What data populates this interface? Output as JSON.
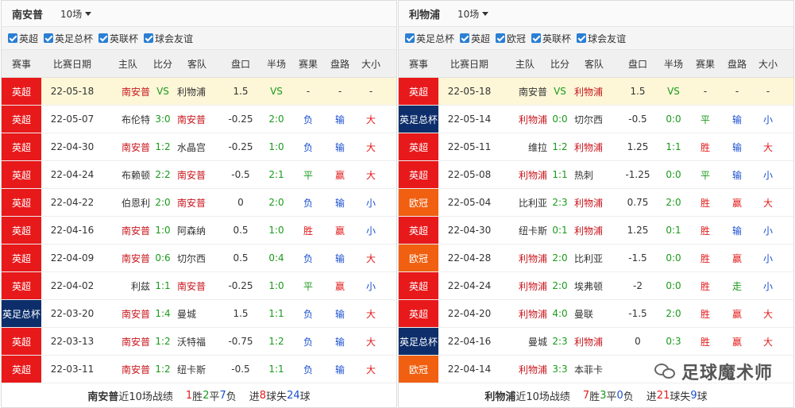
{
  "colors": {
    "epl": "#e8191b",
    "league_cup": "#0d2e6a",
    "europa": "#f06010",
    "highlight_row": "#fdf7d8"
  },
  "headers": {
    "comp": "赛事",
    "date": "比赛日期",
    "home": "主队",
    "score": "比分",
    "away": "客队",
    "handicap": "盘口",
    "halftime": "半场",
    "result": "赛果",
    "pl": "盘路",
    "ou": "大小"
  },
  "left": {
    "team": "南安普",
    "select": "10场",
    "filters": [
      "英超",
      "英足总杯",
      "英联杯",
      "球会友谊"
    ],
    "rows": [
      {
        "comp": "英超",
        "comp_type": "epl",
        "date": "22-05-18",
        "home": "南安普",
        "score": "VS",
        "away": "利物浦",
        "hcp": "1.5",
        "ht": "VS",
        "res": "-",
        "pl": "-",
        "ou": "-",
        "hl": true,
        "home_hl": true,
        "away_hl": false,
        "res_c": "dark",
        "pl_c": "dark",
        "ou_c": "dark"
      },
      {
        "comp": "英超",
        "comp_type": "epl",
        "date": "22-05-07",
        "home": "布伦特",
        "score": "3:0",
        "away": "南安普",
        "hcp": "-0.25",
        "ht": "2:0",
        "res": "负",
        "pl": "输",
        "ou": "大",
        "home_hl": false,
        "away_hl": true,
        "res_c": "blue",
        "pl_c": "blue",
        "ou_c": "red"
      },
      {
        "comp": "英超",
        "comp_type": "epl",
        "date": "22-04-30",
        "home": "南安普",
        "score": "1:2",
        "away": "水晶宫",
        "hcp": "-0.25",
        "ht": "1:0",
        "res": "负",
        "pl": "输",
        "ou": "大",
        "home_hl": true,
        "away_hl": false,
        "res_c": "blue",
        "pl_c": "blue",
        "ou_c": "red"
      },
      {
        "comp": "英超",
        "comp_type": "epl",
        "date": "22-04-24",
        "home": "布赖顿",
        "score": "2:2",
        "away": "南安普",
        "hcp": "-0.5",
        "ht": "2:1",
        "res": "平",
        "pl": "赢",
        "ou": "大",
        "home_hl": false,
        "away_hl": true,
        "res_c": "green",
        "pl_c": "red",
        "ou_c": "red"
      },
      {
        "comp": "英超",
        "comp_type": "epl",
        "date": "22-04-22",
        "home": "伯恩利",
        "score": "2:0",
        "away": "南安普",
        "hcp": "0",
        "ht": "2:0",
        "res": "负",
        "pl": "输",
        "ou": "小",
        "home_hl": false,
        "away_hl": true,
        "res_c": "blue",
        "pl_c": "blue",
        "ou_c": "blue"
      },
      {
        "comp": "英超",
        "comp_type": "epl",
        "date": "22-04-16",
        "home": "南安普",
        "score": "1:0",
        "away": "阿森纳",
        "hcp": "0.5",
        "ht": "1:0",
        "res": "胜",
        "pl": "赢",
        "ou": "小",
        "home_hl": true,
        "away_hl": false,
        "res_c": "red",
        "pl_c": "red",
        "ou_c": "blue"
      },
      {
        "comp": "英超",
        "comp_type": "epl",
        "date": "22-04-09",
        "home": "南安普",
        "score": "0:6",
        "away": "切尔西",
        "hcp": "0.5",
        "ht": "0:4",
        "res": "负",
        "pl": "输",
        "ou": "大",
        "home_hl": true,
        "away_hl": false,
        "res_c": "blue",
        "pl_c": "blue",
        "ou_c": "red"
      },
      {
        "comp": "英超",
        "comp_type": "epl",
        "date": "22-04-02",
        "home": "利兹",
        "score": "1:1",
        "away": "南安普",
        "hcp": "-0.25",
        "ht": "1:0",
        "res": "平",
        "pl": "赢",
        "ou": "小",
        "home_hl": false,
        "away_hl": true,
        "res_c": "green",
        "pl_c": "red",
        "ou_c": "blue"
      },
      {
        "comp": "英足总杯",
        "comp_type": "league_cup",
        "date": "22-03-20",
        "home": "南安普",
        "score": "1:4",
        "away": "曼城",
        "hcp": "1.5",
        "ht": "1:1",
        "res": "负",
        "pl": "输",
        "ou": "大",
        "home_hl": true,
        "away_hl": false,
        "res_c": "blue",
        "pl_c": "blue",
        "ou_c": "red"
      },
      {
        "comp": "英超",
        "comp_type": "epl",
        "date": "22-03-13",
        "home": "南安普",
        "score": "1:2",
        "away": "沃特福",
        "hcp": "-0.75",
        "ht": "1:2",
        "res": "负",
        "pl": "输",
        "ou": "大",
        "home_hl": true,
        "away_hl": false,
        "res_c": "blue",
        "pl_c": "blue",
        "ou_c": "red"
      },
      {
        "comp": "英超",
        "comp_type": "epl",
        "date": "22-03-11",
        "home": "南安普",
        "score": "1:2",
        "away": "纽卡斯",
        "hcp": "-0.5",
        "ht": "1:1",
        "res": "负",
        "pl": "输",
        "ou": "大",
        "home_hl": true,
        "away_hl": false,
        "res_c": "blue",
        "pl_c": "blue",
        "ou_c": "red"
      }
    ],
    "footer": {
      "team": "南安普",
      "label": "近10场战绩",
      "w": "1",
      "w_unit": "胜",
      "d": "2",
      "d_unit": "平",
      "l": "7",
      "l_unit": "负",
      "gf_label": "进",
      "gf": "8",
      "gf_unit": "球失",
      "ga": "24",
      "ga_unit": "球"
    }
  },
  "right": {
    "team": "利物浦",
    "select": "10场",
    "filters": [
      "英足总杯",
      "英超",
      "欧冠",
      "英联杯",
      "球会友谊"
    ],
    "rows": [
      {
        "comp": "英超",
        "comp_type": "epl",
        "date": "22-05-18",
        "home": "南安普",
        "score": "VS",
        "away": "利物浦",
        "hcp": "1.5",
        "ht": "VS",
        "res": "-",
        "pl": "-",
        "ou": "-",
        "hl": true,
        "home_hl": false,
        "away_hl": true,
        "res_c": "dark",
        "pl_c": "dark",
        "ou_c": "dark"
      },
      {
        "comp": "英足总杯",
        "comp_type": "league_cup",
        "date": "22-05-14",
        "home": "利物浦",
        "score": "0:0",
        "away": "切尔西",
        "hcp": "-0.5",
        "ht": "0:0",
        "res": "平",
        "pl": "输",
        "ou": "小",
        "home_hl": true,
        "away_hl": false,
        "res_c": "green",
        "pl_c": "blue",
        "ou_c": "blue"
      },
      {
        "comp": "英超",
        "comp_type": "epl",
        "date": "22-05-11",
        "home": "维拉",
        "score": "1:2",
        "away": "利物浦",
        "hcp": "1.25",
        "ht": "1:1",
        "res": "胜",
        "pl": "输",
        "ou": "大",
        "home_hl": false,
        "away_hl": true,
        "res_c": "red",
        "pl_c": "blue",
        "ou_c": "red"
      },
      {
        "comp": "英超",
        "comp_type": "epl",
        "date": "22-05-08",
        "home": "利物浦",
        "score": "1:1",
        "away": "热刺",
        "hcp": "-1.25",
        "ht": "0:0",
        "res": "平",
        "pl": "输",
        "ou": "小",
        "home_hl": true,
        "away_hl": false,
        "res_c": "green",
        "pl_c": "blue",
        "ou_c": "blue"
      },
      {
        "comp": "欧冠",
        "comp_type": "europa",
        "date": "22-05-04",
        "home": "比利亚",
        "score": "2:3",
        "away": "利物浦",
        "hcp": "0.75",
        "ht": "2:0",
        "res": "胜",
        "pl": "赢",
        "ou": "大",
        "home_hl": false,
        "away_hl": true,
        "res_c": "red",
        "pl_c": "red",
        "ou_c": "red"
      },
      {
        "comp": "英超",
        "comp_type": "epl",
        "date": "22-04-30",
        "home": "纽卡斯",
        "score": "0:1",
        "away": "利物浦",
        "hcp": "1.25",
        "ht": "0:1",
        "res": "胜",
        "pl": "输",
        "ou": "小",
        "home_hl": false,
        "away_hl": true,
        "res_c": "red",
        "pl_c": "blue",
        "ou_c": "blue"
      },
      {
        "comp": "欧冠",
        "comp_type": "europa",
        "date": "22-04-28",
        "home": "利物浦",
        "score": "2:0",
        "away": "比利亚",
        "hcp": "-1.5",
        "ht": "0:0",
        "res": "胜",
        "pl": "赢",
        "ou": "小",
        "home_hl": true,
        "away_hl": false,
        "res_c": "red",
        "pl_c": "red",
        "ou_c": "blue"
      },
      {
        "comp": "英超",
        "comp_type": "epl",
        "date": "22-04-24",
        "home": "利物浦",
        "score": "2:0",
        "away": "埃弗顿",
        "hcp": "-2",
        "ht": "0:0",
        "res": "胜",
        "pl": "走",
        "ou": "小",
        "home_hl": true,
        "away_hl": false,
        "res_c": "red",
        "pl_c": "green",
        "ou_c": "blue"
      },
      {
        "comp": "英超",
        "comp_type": "epl",
        "date": "22-04-20",
        "home": "利物浦",
        "score": "4:0",
        "away": "曼联",
        "hcp": "-1.5",
        "ht": "2:0",
        "res": "胜",
        "pl": "赢",
        "ou": "大",
        "home_hl": true,
        "away_hl": false,
        "res_c": "red",
        "pl_c": "red",
        "ou_c": "red"
      },
      {
        "comp": "英足总杯",
        "comp_type": "league_cup",
        "date": "22-04-16",
        "home": "曼城",
        "score": "2:3",
        "away": "利物浦",
        "hcp": "0",
        "ht": "0:3",
        "res": "胜",
        "pl": "赢",
        "ou": "大",
        "home_hl": false,
        "away_hl": true,
        "res_c": "red",
        "pl_c": "red",
        "ou_c": "red"
      },
      {
        "comp": "欧冠",
        "comp_type": "europa",
        "date": "22-04-14",
        "home": "利物浦",
        "score": "3:3",
        "away": "本菲卡",
        "hcp": "",
        "ht": "",
        "res": "",
        "pl": "",
        "ou": "",
        "home_hl": true,
        "away_hl": false,
        "res_c": "dark",
        "pl_c": "dark",
        "ou_c": "dark"
      }
    ],
    "footer": {
      "team": "利物浦",
      "label": "近10场战绩",
      "w": "7",
      "w_unit": "胜",
      "d": "3",
      "d_unit": "平",
      "l": "0",
      "l_unit": "负",
      "gf_label": "进",
      "gf": "21",
      "gf_unit": "球失",
      "ga": "9",
      "ga_unit": "球"
    }
  },
  "watermark": {
    "text": "足球魔术师",
    "icon": "wechat-icon"
  }
}
